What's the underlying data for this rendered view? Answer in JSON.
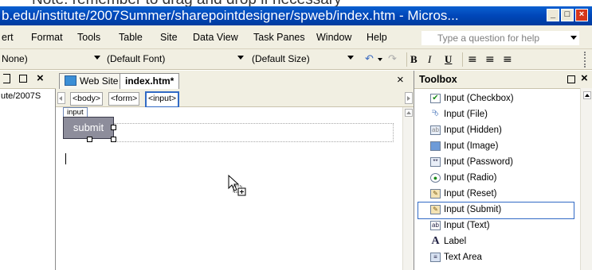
{
  "caption": "Note: remember to drag and drop if necessary",
  "window": {
    "title": "b.edu/institute/2007Summer/sharepointdesigner/spweb/index.htm - Micros...",
    "min": "_",
    "max": "□",
    "close": "×"
  },
  "menu": {
    "items": [
      "ert",
      "Format",
      "Tools",
      "Table",
      "Site",
      "Data View",
      "Task Panes",
      "Window",
      "Help"
    ],
    "help_placeholder": "Type a question for help"
  },
  "format_toolbar": {
    "style_value": "None)",
    "font_value": "(Default Font)",
    "size_value": "(Default Size)",
    "bold": "B",
    "italic": "I",
    "underline": "U"
  },
  "left_pane": {
    "path_text": "ute/2007S",
    "close": "×"
  },
  "document": {
    "tabs": [
      "Web Site",
      "index.htm*"
    ],
    "close": "×",
    "quick_tags": [
      "<body>",
      "<form>",
      "<input>"
    ],
    "input_tag_label": "input",
    "submit_label": "submit"
  },
  "toolbox": {
    "title": "Toolbox",
    "close": "×",
    "items": [
      {
        "label": "Input (Checkbox)",
        "icon": "checkbox-icon"
      },
      {
        "label": "Input (File)",
        "icon": "file-icon"
      },
      {
        "label": "Input (Hidden)",
        "icon": "hidden-icon"
      },
      {
        "label": "Input (Image)",
        "icon": "image-icon"
      },
      {
        "label": "Input (Password)",
        "icon": "password-icon"
      },
      {
        "label": "Input (Radio)",
        "icon": "radio-icon"
      },
      {
        "label": "Input (Reset)",
        "icon": "reset-icon"
      },
      {
        "label": "Input (Submit)",
        "icon": "submit-icon"
      },
      {
        "label": "Input (Text)",
        "icon": "text-icon"
      },
      {
        "label": "Label",
        "icon": "label-icon"
      },
      {
        "label": "Text Area",
        "icon": "textarea-icon"
      }
    ],
    "selected_index": 7
  },
  "colors": {
    "titlebar": "#0054e3",
    "chrome": "#f1efe2",
    "selection_border": "#316ac5"
  }
}
